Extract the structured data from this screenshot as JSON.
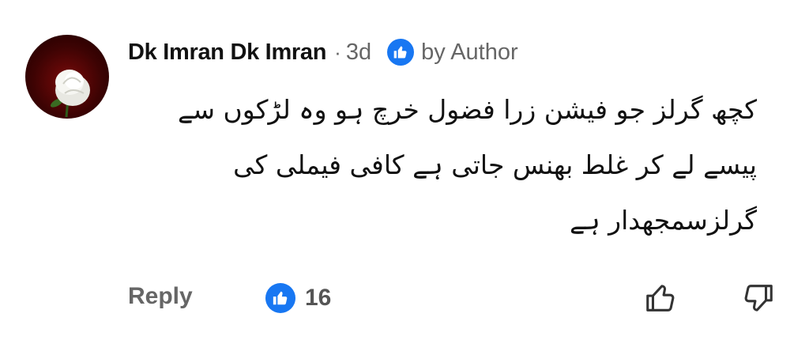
{
  "comment": {
    "author": "Dk Imran Dk Imran",
    "separator": "·",
    "age": "3d",
    "liked_by": "by Author",
    "text_lines": [
      "کچھ گرلز جو فیشن زرا فضول خرچ ہو وہ لڑکوں سے",
      "پیسے لے کر غلط بھنس جاتی ہے کافی فیملی کی",
      "گرلزسمجھدار ہے"
    ],
    "avatar_icon": "white-rose-avatar"
  },
  "actions": {
    "reply_label": "Reply",
    "like_count": "16",
    "like_icon": "thumbs-up-icon",
    "dislike_icon": "thumbs-down-icon"
  },
  "colors": {
    "accent": "#1877f2",
    "muted_text": "#666666",
    "text": "#111111"
  }
}
